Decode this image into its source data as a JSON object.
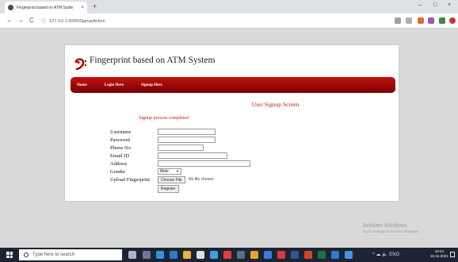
{
  "browser": {
    "tab_title": "Fingerprint based on ATM Syste",
    "tab_close": "×",
    "new_tab": "+",
    "back": "←",
    "forward": "→",
    "reload": "C",
    "info": "ⓘ",
    "url": "127.0.0.1:5000/SignupAction",
    "minimize": "–",
    "maximize": "□",
    "close": "×"
  },
  "app": {
    "logo_text": "Fingerprint based on ATM System",
    "nav": [
      "Home",
      "Login Here",
      "Signup Here"
    ],
    "screen_title": "User Signup Screen",
    "status": "Signup process completed"
  },
  "form": {
    "username_label": "Username",
    "password_label": "Password",
    "phone_label": "Phone No",
    "email_label": "Email ID",
    "address_label": "Address",
    "gender_label": "Gender",
    "gender_value": "Male",
    "fingerprint_label": "Upload Fingerprint",
    "choose_file": "Choose File",
    "no_file": "No file chosen",
    "register": "Register"
  },
  "watermark": {
    "line1": "Activate Windows",
    "line2": "Go to Settings to activate Windows."
  },
  "taskbar": {
    "search_placeholder": "Type here to search",
    "tray": "^ ☁ 🔈 ENG",
    "time": "18:44",
    "date": "15-11-2021"
  },
  "colors": {
    "nav_red": "#b00000",
    "accent_red": "#d21414"
  }
}
